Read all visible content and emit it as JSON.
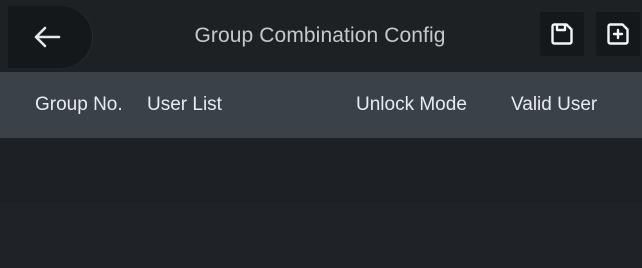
{
  "header": {
    "title": "Group Combination Config"
  },
  "table": {
    "columns": [
      "Group No.",
      "User List",
      "Unlock Mode",
      "Valid User"
    ],
    "rows": []
  },
  "icons": {
    "back": "arrow-left-icon",
    "save": "save-icon",
    "add": "add-icon"
  },
  "colors": {
    "background": "#1b1f24",
    "topbar": "#1e2124",
    "table_header": "#394149",
    "text": "#e9ecef",
    "title_text": "#c5c9cd"
  }
}
